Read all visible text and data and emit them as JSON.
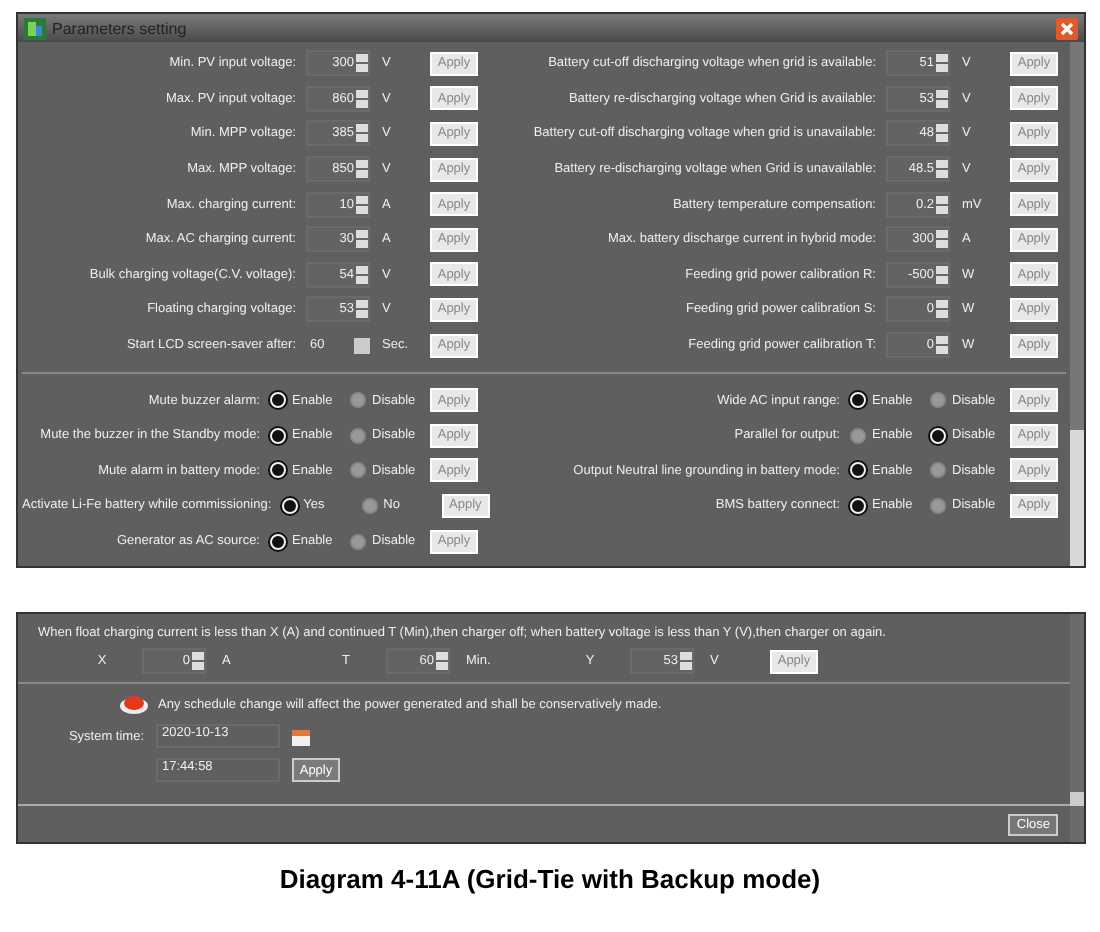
{
  "window": {
    "title": "Parameters setting"
  },
  "voltage_settings": {
    "left": [
      {
        "label": "Min. PV input voltage:",
        "value": "300",
        "unit": "V",
        "apply": {
          "label": "Apply",
          "disabled": true
        }
      },
      {
        "label": "Max. PV input voltage:",
        "value": "860",
        "unit": "V",
        "apply": {
          "label": "Apply",
          "disabled": true
        }
      },
      {
        "label": "Min. MPP voltage:",
        "value": "385",
        "unit": "V",
        "apply": {
          "label": "Apply",
          "disabled": true
        }
      },
      {
        "label": "Max. MPP voltage:",
        "value": "850",
        "unit": "V",
        "apply": {
          "label": "Apply",
          "disabled": true
        }
      },
      {
        "label": "Max. charging current:",
        "value": "10",
        "unit": "A",
        "apply": {
          "label": "Apply",
          "disabled": true
        }
      },
      {
        "label": "Max. AC charging current:",
        "value": "30",
        "unit": "A",
        "apply": {
          "label": "Apply",
          "disabled": true
        }
      },
      {
        "label": "Bulk charging voltage(C.V. voltage):",
        "value": "54",
        "unit": "V",
        "apply": {
          "label": "Apply",
          "disabled": true
        }
      },
      {
        "label": "Floating charging voltage:",
        "value": "53",
        "unit": "V",
        "apply": {
          "label": "Apply",
          "disabled": true
        }
      }
    ],
    "right": [
      {
        "label": "Battery cut-off discharging voltage when grid is available:",
        "value": "51",
        "unit": "V",
        "apply": {
          "label": "Apply",
          "disabled": true
        }
      },
      {
        "label": "Battery re-discharging voltage when Grid is available:",
        "value": "53",
        "unit": "V",
        "apply": {
          "label": "Apply",
          "disabled": true
        }
      },
      {
        "label": "Battery cut-off discharging voltage when grid is unavailable:",
        "value": "48",
        "unit": "V",
        "apply": {
          "label": "Apply",
          "disabled": true
        }
      },
      {
        "label": "Battery re-discharging voltage when Grid is unavailable:",
        "value": "48.5",
        "unit": "V",
        "apply": {
          "label": "Apply",
          "disabled": true
        }
      },
      {
        "label": "Battery temperature compensation:",
        "value": "0.2",
        "unit": "mV",
        "apply": {
          "label": "Apply",
          "disabled": true
        }
      },
      {
        "label": "Max. battery discharge current in hybrid mode:",
        "value": "300",
        "unit": "A",
        "apply": {
          "label": "Apply",
          "disabled": true
        }
      },
      {
        "label": "Feeding grid power calibration R:",
        "value": "-500",
        "unit": "W",
        "apply": {
          "label": "Apply",
          "disabled": true
        }
      },
      {
        "label": "Feeding grid power calibration S:",
        "value": "0",
        "unit": "W",
        "apply": {
          "label": "Apply",
          "disabled": true
        }
      },
      {
        "label": "Feeding grid power calibration T:",
        "value": "0",
        "unit": "W",
        "apply": {
          "label": "Apply",
          "disabled": true
        }
      }
    ]
  },
  "screensaver": {
    "label": "Start LCD screen-saver after:",
    "value": "60",
    "unit": "Sec.",
    "apply": {
      "label": "Apply",
      "disabled": true
    }
  },
  "toggles": {
    "left": [
      {
        "label": "Mute buzzer alarm:",
        "options": [
          {
            "label": "Enable",
            "selected": true
          },
          {
            "label": "Disable",
            "selected": false
          }
        ],
        "apply": {
          "label": "Apply",
          "disabled": true
        }
      },
      {
        "label": "Mute the buzzer in the Standby mode:",
        "options": [
          {
            "label": "Enable",
            "selected": true
          },
          {
            "label": "Disable",
            "selected": false
          }
        ],
        "apply": {
          "label": "Apply",
          "disabled": true
        }
      },
      {
        "label": "Mute alarm in battery mode:",
        "options": [
          {
            "label": "Enable",
            "selected": true
          },
          {
            "label": "Disable",
            "selected": false
          }
        ],
        "apply": {
          "label": "Apply",
          "disabled": true
        }
      },
      {
        "label": "Activate Li-Fe battery while commissioning:",
        "options": [
          {
            "label": "Yes",
            "selected": true
          },
          {
            "label": "No",
            "selected": false
          }
        ],
        "apply": {
          "label": "Apply",
          "disabled": true
        }
      },
      {
        "label": "Generator as AC source:",
        "options": [
          {
            "label": "Enable",
            "selected": true
          },
          {
            "label": "Disable",
            "selected": false
          }
        ],
        "apply": {
          "label": "Apply",
          "disabled": true
        }
      }
    ],
    "right": [
      {
        "label": "Wide AC input range:",
        "options": [
          {
            "label": "Enable",
            "selected": true
          },
          {
            "label": "Disable",
            "selected": false
          }
        ],
        "apply": {
          "label": "Apply",
          "disabled": true
        }
      },
      {
        "label": "Parallel for output:",
        "options": [
          {
            "label": "Enable",
            "selected": false
          },
          {
            "label": "Disable",
            "selected": true
          }
        ],
        "apply": {
          "label": "Apply",
          "disabled": true
        }
      },
      {
        "label": "Output Neutral line grounding in battery mode:",
        "options": [
          {
            "label": "Enable",
            "selected": true
          },
          {
            "label": "Disable",
            "selected": false
          }
        ],
        "apply": {
          "label": "Apply",
          "disabled": true
        }
      },
      {
        "label": "BMS battery connect:",
        "options": [
          {
            "label": "Enable",
            "selected": true
          },
          {
            "label": "Disable",
            "selected": false
          }
        ],
        "apply": {
          "label": "Apply",
          "disabled": true
        }
      }
    ]
  },
  "float_rule": {
    "text": "When float charging current is less than X (A) and continued T (Min),then charger off; when battery voltage is less than Y (V),then charger on again.",
    "fields": [
      {
        "label": "X",
        "value": "0",
        "unit": "A"
      },
      {
        "label": "T",
        "value": "60",
        "unit": "Min."
      },
      {
        "label": "Y",
        "value": "53",
        "unit": "V"
      }
    ],
    "apply": {
      "label": "Apply",
      "disabled": true
    }
  },
  "notice": "Any schedule change will affect the power generated and shall be conservatively made.",
  "system_time": {
    "label": "System time:",
    "date": "2020-10-13",
    "time": "17:44:58",
    "apply": {
      "label": "Apply",
      "disabled": false
    }
  },
  "close_button": "Close",
  "caption": "Diagram 4-11A (Grid-Tie with Backup mode)"
}
